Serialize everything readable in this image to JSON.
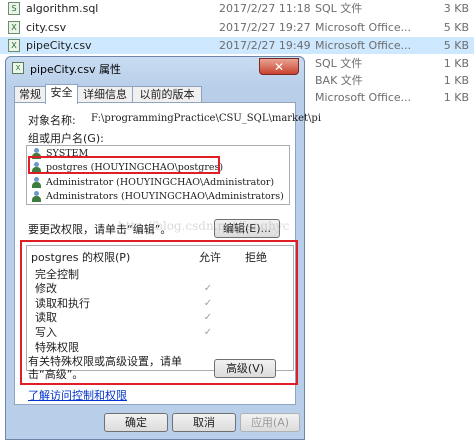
{
  "files": [
    {
      "icon": "sql",
      "name": "algorithm.sql",
      "date": "2017/2/27 11:18",
      "type": "SQL 文件",
      "size": "3 KB"
    },
    {
      "icon": "csv",
      "name": "city.csv",
      "date": "2017/2/27 19:27",
      "type": "Microsoft Office...",
      "size": "5 KB"
    },
    {
      "icon": "csv",
      "name": "pipeCity.csv",
      "date": "2017/2/27 19:49",
      "type": "Microsoft Office...",
      "size": "5 KB"
    },
    {
      "icon": "",
      "name": "",
      "date": "",
      "type": "SQL 文件",
      "size": "1 KB"
    },
    {
      "icon": "",
      "name": "",
      "date": "",
      "type": "BAK 文件",
      "size": "1 KB"
    },
    {
      "icon": "",
      "name": "",
      "date": "",
      "type": "Microsoft Office...",
      "size": "1 KB"
    }
  ],
  "dialog": {
    "title": "pipeCity.csv 属性",
    "close_glyph": "✕",
    "tabs": [
      "常规",
      "安全",
      "详细信息",
      "以前的版本"
    ],
    "active_tab": "安全",
    "object_label": "对象名称:",
    "object_path": "F:\\programmingPractice\\CSU_SQL\\market\\pi",
    "group_label": "组或用户名(G):",
    "users": [
      "SYSTEM",
      "postgres (HOUYINGCHAO\\postgres)",
      "Administrator (HOUYINGCHAO\\Administrator)",
      "Administrators (HOUYINGCHAO\\Administrators)"
    ],
    "selected_user_index": 1,
    "change_text": "要更改权限，请单击“编辑”。",
    "edit_button": "编辑(E)...",
    "perm_label": "postgres 的权限(P)",
    "allow_label": "允许",
    "deny_label": "拒绝",
    "permissions": [
      {
        "name": "完全控制",
        "allow": false
      },
      {
        "name": "修改",
        "allow": true
      },
      {
        "name": "读取和执行",
        "allow": true
      },
      {
        "name": "读取",
        "allow": true
      },
      {
        "name": "写入",
        "allow": true
      },
      {
        "name": "特殊权限",
        "allow": false
      }
    ],
    "check_glyph": "✓",
    "special_text": "有关特殊权限或高级设置，请单击“高级”。",
    "advanced_button": "高级(V)",
    "learn_link": "了解访问控制和权限",
    "ok_button": "确定",
    "cancel_button": "取消",
    "apply_button": "应用(A)",
    "watermark": "http://blog.csdn.net/fenghyc"
  }
}
